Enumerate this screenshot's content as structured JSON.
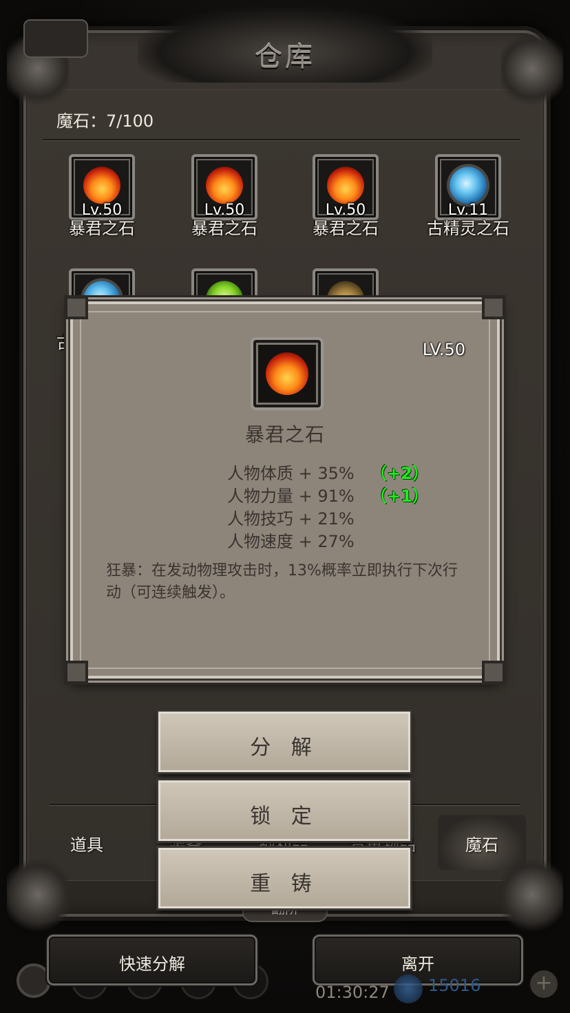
{
  "window": {
    "title": "仓库"
  },
  "inventory": {
    "count_label": "魔石：7/100",
    "items": [
      {
        "level": "Lv.50",
        "name": "暴君之石",
        "gem": "fire-stone-icon"
      },
      {
        "level": "Lv.50",
        "name": "暴君之石",
        "gem": "fire-stone-icon"
      },
      {
        "level": "Lv.50",
        "name": "暴君之石",
        "gem": "fire-stone-icon"
      },
      {
        "level": "Lv.11",
        "name": "古精灵之石",
        "gem": "ice-stone-icon"
      },
      {
        "name": "古",
        "gem": "ice-stone-icon"
      },
      {
        "gem": "green-crystal-icon"
      },
      {
        "gem": "gold-relic-icon"
      }
    ]
  },
  "tabs": [
    {
      "label": "道具"
    },
    {
      "label": "装备"
    },
    {
      "label": "战利品"
    },
    {
      "label": "贵重物品"
    },
    {
      "label": "魔石",
      "active": true
    }
  ],
  "paging": {
    "label": "翻阶"
  },
  "detail": {
    "level": "LV.50",
    "name": "暴君之石",
    "stats": [
      {
        "text": "人物体质 + 35%",
        "bonus": "（+2）"
      },
      {
        "text": "人物力量 + 91%",
        "bonus": "（+1）"
      },
      {
        "text": "人物技巧 + 21%"
      },
      {
        "text": "人物速度 + 27%"
      }
    ],
    "description": "狂暴：在发动物理攻击时，13%概率立即执行下次行动（可连续触发）。"
  },
  "actions": {
    "decompose": "分 解",
    "lock": "锁 定",
    "reforge": "重 铸"
  },
  "footer": {
    "quick_decompose": "快速分解",
    "leave": "离开",
    "timer": "01:30:27",
    "currency": "15016"
  },
  "colors": {
    "bonus": "#1eea1e",
    "panel": "#8e857a",
    "frame": "#3a3530"
  }
}
